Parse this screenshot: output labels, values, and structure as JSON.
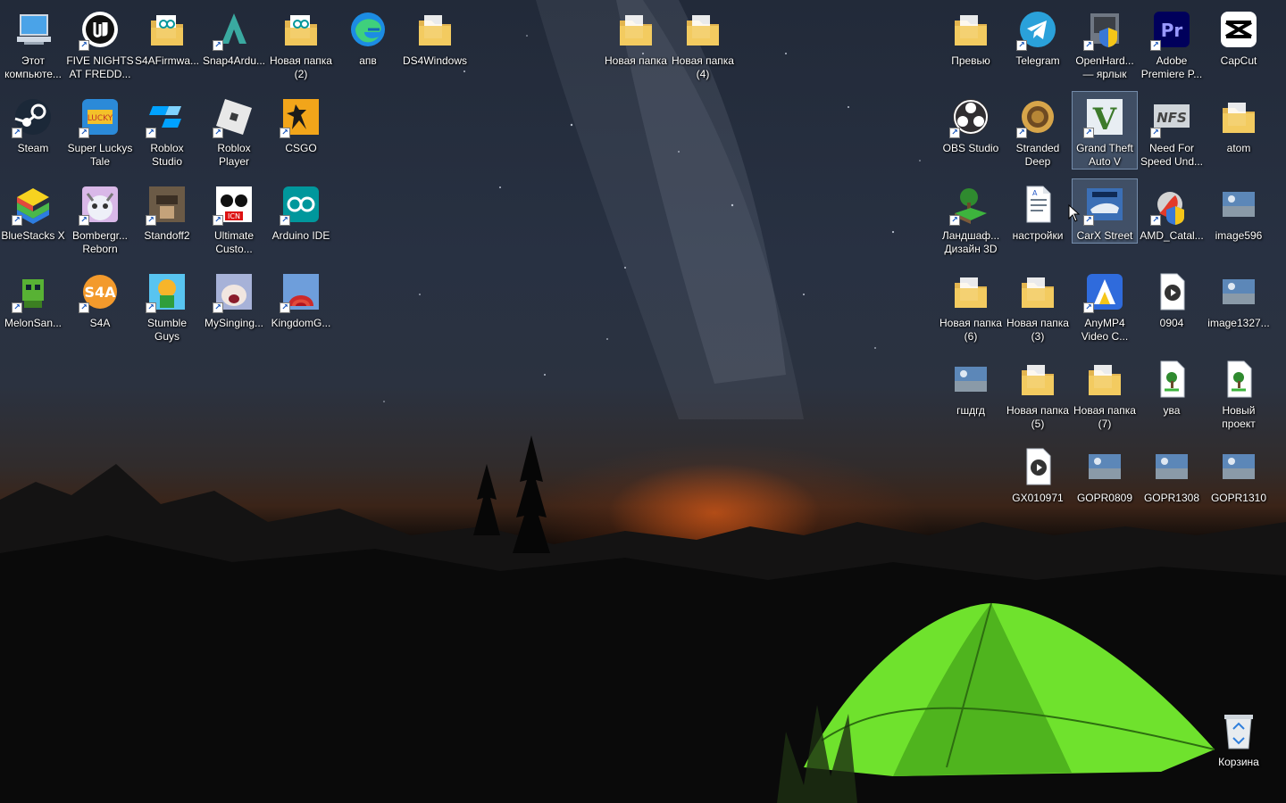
{
  "desktop": {
    "left_icons": [
      {
        "label": "Этот\nкомпьюте...",
        "icon": "computer-icon"
      },
      {
        "label": "FIVE NIGHTS\nAT FREDD...",
        "icon": "unreal-engine-icon"
      },
      {
        "label": "S4AFirmwa...",
        "icon": "arduino-folder-icon"
      },
      {
        "label": "Snap4Ardu...",
        "icon": "snap4arduino-icon"
      },
      {
        "label": "Новая папка\n(2)",
        "icon": "arduino-folder-icon"
      },
      {
        "label": "апв",
        "icon": "edge-icon"
      },
      {
        "label": "DS4Windows",
        "icon": "folder-icon"
      },
      {
        "label": "Steam",
        "icon": "steam-icon"
      },
      {
        "label": "Super Luckys\nTale",
        "icon": "super-luckys-tale-icon"
      },
      {
        "label": "Roblox\nStudio",
        "icon": "roblox-studio-icon"
      },
      {
        "label": "Roblox\nPlayer",
        "icon": "roblox-player-icon"
      },
      {
        "label": "CSGO",
        "icon": "csgo-icon"
      },
      {
        "label": "BlueStacks X",
        "icon": "bluestacks-icon"
      },
      {
        "label": "Bombergr...\nReborn",
        "icon": "bombergrounds-icon"
      },
      {
        "label": "Standoff2",
        "icon": "standoff2-icon"
      },
      {
        "label": "Ultimate\nCusto...",
        "icon": "ultimate-custom-night-icon"
      },
      {
        "label": "Arduino IDE",
        "icon": "arduino-ide-icon"
      },
      {
        "label": "MelonSan...",
        "icon": "melon-sandbox-icon"
      },
      {
        "label": "S4A",
        "icon": "s4a-icon"
      },
      {
        "label": "Stumble\nGuys",
        "icon": "stumble-guys-icon"
      },
      {
        "label": "MySinging...",
        "icon": "my-singing-monsters-icon"
      },
      {
        "label": "KingdomG...",
        "icon": "kingdom-game-icon"
      }
    ],
    "top_folders": [
      {
        "label": "Новая папка",
        "icon": "folder-icon"
      },
      {
        "label": "Новая папка\n(4)",
        "icon": "folder-icon"
      }
    ],
    "right_icons": [
      {
        "label": "Превью",
        "icon": "folder-icon"
      },
      {
        "label": "Telegram",
        "icon": "telegram-icon"
      },
      {
        "label": "OpenHard...\n— ярлык",
        "icon": "openhardware-icon"
      },
      {
        "label": "Adobe\nPremiere P...",
        "icon": "premiere-pro-icon"
      },
      {
        "label": "CapCut",
        "icon": "capcut-icon"
      },
      {
        "label": "OBS Studio",
        "icon": "obs-icon"
      },
      {
        "label": "Stranded\nDeep",
        "icon": "stranded-deep-icon"
      },
      {
        "label": "Grand Theft\nAuto V",
        "icon": "gta-v-icon",
        "selected": true
      },
      {
        "label": "Need For\nSpeed Und...",
        "icon": "nfs-icon"
      },
      {
        "label": "atom",
        "icon": "folder-icon"
      },
      {
        "label": "Ландшаф...\nДизайн 3D",
        "icon": "landscape-design-icon"
      },
      {
        "label": "настройки",
        "icon": "document-icon"
      },
      {
        "label": "CarX Street",
        "icon": "carx-street-icon",
        "selected": true
      },
      {
        "label": "AMD_Catal...",
        "icon": "amd-catalyst-icon"
      },
      {
        "label": "image596",
        "icon": "image-file-icon"
      },
      {
        "label": "Новая папка\n(6)",
        "icon": "folder-icon"
      },
      {
        "label": "Новая папка\n(3)",
        "icon": "folder-icon"
      },
      {
        "label": "AnyMP4\nVideo C...",
        "icon": "anymp4-icon"
      },
      {
        "label": "0904",
        "icon": "video-file-icon"
      },
      {
        "label": "image1327...",
        "icon": "image-file-icon"
      },
      {
        "label": "гшдгд",
        "icon": "image-file-icon"
      },
      {
        "label": "Новая папка\n(5)",
        "icon": "folder-icon"
      },
      {
        "label": "Новая папка\n(7)",
        "icon": "folder-icon"
      },
      {
        "label": "ува",
        "icon": "project-file-icon"
      },
      {
        "label": "Новый\nпроект",
        "icon": "project-file-icon"
      },
      {
        "label": "GX010971",
        "icon": "video-file-icon"
      },
      {
        "label": "GOPR0809",
        "icon": "image-file-icon"
      },
      {
        "label": "GOPR1308",
        "icon": "image-file-icon"
      },
      {
        "label": "GOPR1310",
        "icon": "image-file-icon"
      }
    ],
    "recycle_bin": {
      "label": "Корзина",
      "icon": "recycle-bin-icon"
    }
  },
  "colors": {
    "sky_top": "#222a39",
    "horizon_glow": "#ff6a19",
    "tent_green": "#6fe22d",
    "selection": "#7896b9"
  }
}
